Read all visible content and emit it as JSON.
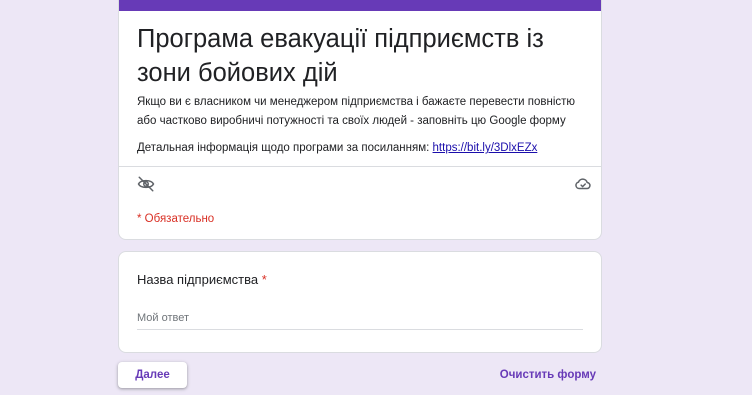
{
  "form": {
    "title": "Програма евакуації підприємств із зони бойових дій",
    "description": "Якщо ви є власником чи менеджером підприємства і бажаєте перевести повністю або частково виробничі потужності та своїх людей - заповніть цю Google форму",
    "info_text": "Детальная інформація щодо програми за посиланням: ",
    "info_link": "https://bit.ly/3DlxEZx",
    "required_note": "* Обязательно",
    "accent_color": "#673ab7",
    "background_color": "#ede7f6",
    "icons": {
      "left": "visibility-off-icon",
      "right": "cloud-done-icon"
    }
  },
  "question": {
    "label": "Назва підприємства",
    "required_mark": "*",
    "placeholder": "Мой ответ",
    "value": ""
  },
  "footer": {
    "next_label": "Далее",
    "clear_label": "Очистить форму"
  }
}
